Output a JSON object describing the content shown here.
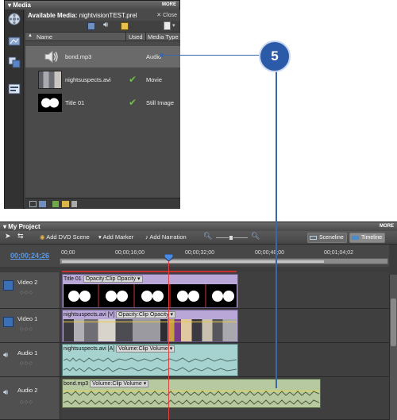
{
  "media_panel": {
    "title": "Media",
    "more": "MORE",
    "available_label": "Available Media:",
    "project_file": "nightvisionTEST.prel",
    "close_label": "Close",
    "columns": {
      "name": "Name",
      "used": "Used",
      "media_type": "Media Type"
    },
    "items": [
      {
        "name": "bond.mp3",
        "type": "Audio",
        "used": false
      },
      {
        "name": "nightsuspects.avi",
        "type": "Movie",
        "used": true
      },
      {
        "name": "Title 01",
        "type": "Still Image",
        "used": true
      }
    ]
  },
  "callout": {
    "number": "5"
  },
  "project_panel": {
    "title": "My Project",
    "more": "MORE",
    "toolbar": {
      "add_dvd_scene": "Add DVD Scene",
      "add_marker": "Add Marker",
      "add_narration": "Add Narration",
      "sceneline": "Sceneline",
      "timeline": "Timeline"
    },
    "timecode": "00;00;24;26",
    "ruler_ticks": [
      "00;00",
      "00;00;16;00",
      "00;00;32;00",
      "00;00;48;00",
      "00;01;04;02"
    ],
    "tracks": [
      {
        "name": "Video 2",
        "clip_name": "Title 01",
        "clip_prop": "Opacity:Clip Opacity"
      },
      {
        "name": "Video 1",
        "clip_name": "nightsuspects.avi [V]",
        "clip_prop": "Opacity:Clip Opacity"
      },
      {
        "name": "Audio 1",
        "clip_name": "nightsuspects.avi [A]",
        "clip_prop": "Volume:Clip Volume"
      },
      {
        "name": "Audio 2",
        "clip_name": "bond.mp3",
        "clip_prop": "Volume:Clip Volume"
      }
    ]
  },
  "colors": {
    "accent_blue": "#2b5aa8",
    "timecode_blue": "#5a9ae8",
    "playhead_red": "#e04040",
    "video_clip": "#b9a7d8",
    "audio_clip": "#a6d3cf",
    "audio2_clip": "#b7c9a0"
  }
}
